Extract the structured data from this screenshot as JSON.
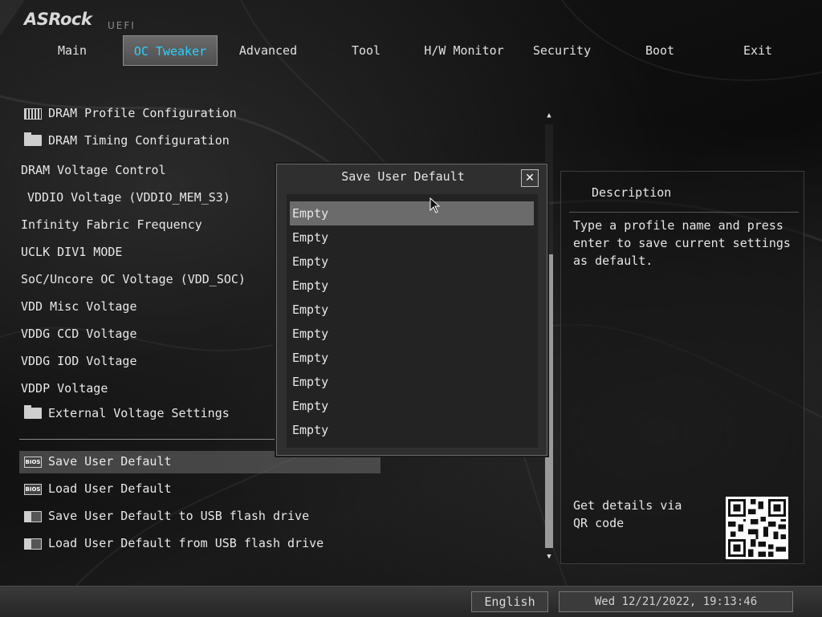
{
  "brand": {
    "logo": "ASRock",
    "sub": "UEFI"
  },
  "tabs": [
    {
      "label": "Main"
    },
    {
      "label": "OC Tweaker",
      "active": true
    },
    {
      "label": "Advanced"
    },
    {
      "label": "Tool"
    },
    {
      "label": "H/W Monitor"
    },
    {
      "label": "Security"
    },
    {
      "label": "Boot"
    },
    {
      "label": "Exit"
    }
  ],
  "menu": {
    "items": [
      {
        "label": "DRAM Profile Configuration",
        "icon": "profile-icon"
      },
      {
        "label": "DRAM Timing Configuration",
        "icon": "folder-icon"
      },
      {
        "label": "DRAM Voltage Control"
      },
      {
        "label": "VDDIO Voltage (VDDIO_MEM_S3)"
      },
      {
        "label": "Infinity Fabric Frequency"
      },
      {
        "label": "UCLK DIV1 MODE"
      },
      {
        "label": "SoC/Uncore OC Voltage (VDD_SOC)"
      },
      {
        "label": "VDD Misc Voltage"
      },
      {
        "label": "VDDG CCD Voltage"
      },
      {
        "label": "VDDG IOD Voltage"
      },
      {
        "label": "VDDP Voltage"
      },
      {
        "label": "External Voltage Settings",
        "icon": "folder-icon"
      },
      {
        "label": "Save User Default",
        "icon": "bios-icon",
        "selected": true
      },
      {
        "label": "Load User Default",
        "icon": "bios-icon"
      },
      {
        "label": "Save User Default to USB flash drive",
        "icon": "usb-save-icon"
      },
      {
        "label": "Load User Default from USB flash drive",
        "icon": "usb-load-icon"
      }
    ],
    "bios_icon_text": "BIOS"
  },
  "dialog": {
    "title": "Save User Default",
    "close_glyph": "✕",
    "slots": [
      "Empty",
      "Empty",
      "Empty",
      "Empty",
      "Empty",
      "Empty",
      "Empty",
      "Empty",
      "Empty",
      "Empty"
    ]
  },
  "description": {
    "title": "Description",
    "text": "Type a profile name and press enter to save current settings as default.",
    "qr_text": "Get details via QR code"
  },
  "footer": {
    "language": "English",
    "datetime": "Wed 12/21/2022, 19:13:46"
  },
  "scroll": {
    "up_glyph": "▲",
    "down_glyph": "▼"
  }
}
